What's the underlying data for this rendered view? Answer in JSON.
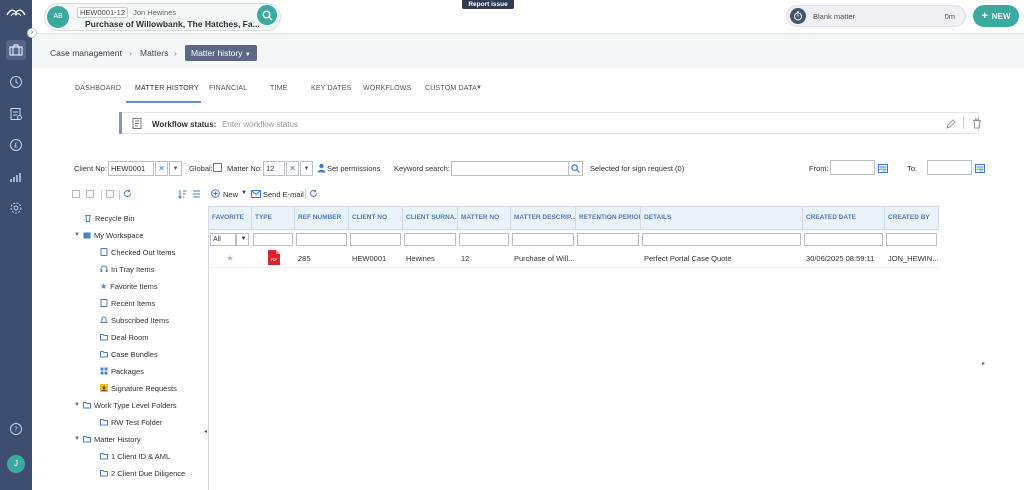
{
  "topbar": {
    "avatar_initials": "AB",
    "matter_ref": "HEW0001-12",
    "client_name": "Jon Hewines",
    "matter_title": "Purchase of Willowbank, The Hatches, Fa...",
    "report_issue": "Report issue",
    "timer_label": "Blank matter",
    "timer_duration": "0m",
    "new_label": "NEW"
  },
  "rail": {
    "user_initial": "J"
  },
  "breadcrumb": {
    "items": [
      "Case management",
      "Matters"
    ],
    "current": "Matter history"
  },
  "tabs": [
    "DASHBOARD",
    "MATTER HISTORY",
    "FINANCIAL",
    "TIME",
    "KEY DATES",
    "WORKFLOWS",
    "CUSTOM DATA"
  ],
  "workflow": {
    "label": "Workflow status:",
    "placeholder": "Enter workflow status"
  },
  "filters": {
    "client_no_label": "Client No:",
    "client_no_value": "HEW0001",
    "global_label": "Global:",
    "matter_no_label": "Matter No:",
    "matter_no_value": "12",
    "set_permissions": "Set permissions",
    "keyword_label": "Keyword search:",
    "sign_request": "Selected for sign request (0)",
    "from_label": "From:",
    "to_label": "To:"
  },
  "grid_toolbar": {
    "new_label": "New",
    "send_email": "Send E-mail"
  },
  "tree": {
    "recycle_bin": "Recycle Bin",
    "my_workspace": "My Workspace",
    "workspace_items": [
      "Checked Out Items",
      "In Tray Items",
      "Favorite Items",
      "Recent Items",
      "Subscribed Items",
      "Deal Room",
      "Case Bundles",
      "Packages",
      "Signature Requests"
    ],
    "work_type_folders": "Work Type Level Folders",
    "rw_test_folder": "RW Test Folder",
    "matter_history": "Matter History",
    "history_items": [
      "1 Client ID & AML",
      "2 Client Due Diligence"
    ]
  },
  "grid": {
    "columns": [
      "FAVORITE",
      "TYPE",
      "REF NUMBER",
      "CLIENT NO",
      "CLIENT SURNA...",
      "MATTER NO",
      "MATTER DESCRIP...",
      "RETENTION PERIOD",
      "DETAILS",
      "CREATED DATE",
      "CREATED BY"
    ],
    "favorite_filter": "All",
    "rows": [
      {
        "type_icon": "pdf-icon",
        "ref": "285",
        "client_no": "HEW0001",
        "surname": "Hewines",
        "matter_no": "12",
        "description": "Purchase of Will...",
        "retention": "",
        "details": "Perfect Portal Case Quote",
        "created_date": "30/06/2025 08:59:11",
        "created_by": "JON_HEWIN..."
      }
    ]
  },
  "colors": {
    "teal": "#3aa99f",
    "rail": "#3d4e6e",
    "accent_blue": "#4d7fc4"
  }
}
